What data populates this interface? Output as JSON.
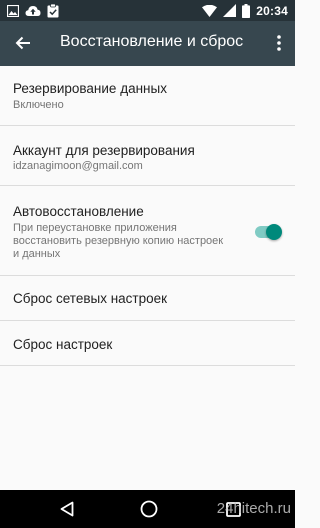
{
  "status_bar": {
    "time": "20:34",
    "icons_left": [
      "image-icon",
      "cloud-upload-icon",
      "clipboard-check-icon"
    ],
    "icons_right": [
      "wifi-icon",
      "signal-icon",
      "battery-icon"
    ]
  },
  "toolbar": {
    "title": "Восстановление и сброс",
    "back_icon": "arrow-back-icon",
    "menu_icon": "more-vert-icon"
  },
  "settings": {
    "items": [
      {
        "title": "Резервирование данных",
        "subtitle": "Включено"
      },
      {
        "title": "Аккаунт для резервирования",
        "subtitle": "idzanagimoon@gmail.com"
      },
      {
        "title": "Автовосстановление",
        "subtitle": "При переустановке приложения восстановить резервную копию настроек и данных",
        "toggle_on": true
      },
      {
        "title": "Сброс сетевых настроек"
      },
      {
        "title": "Сброс настроек"
      }
    ]
  },
  "colors": {
    "status_bar": "#263238",
    "toolbar": "#37474f",
    "accent": "#00897b",
    "accent_track": "#80cbc4",
    "background": "#fafafa"
  },
  "nav_bar": {
    "icons": [
      "back-triangle-icon",
      "home-circle-icon",
      "recents-square-icon"
    ]
  },
  "watermark": "24hitech.ru"
}
